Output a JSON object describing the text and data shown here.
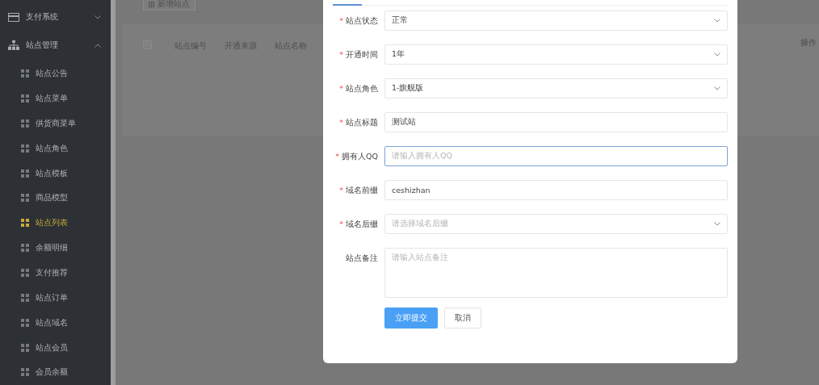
{
  "sidebar": {
    "groups": [
      {
        "label": "支付系统",
        "expanded": false
      },
      {
        "label": "站点管理",
        "expanded": true,
        "children": [
          {
            "label": "站点公告",
            "selected": false
          },
          {
            "label": "站点菜单",
            "selected": false
          },
          {
            "label": "供货商菜单",
            "selected": false
          },
          {
            "label": "站点角色",
            "selected": false
          },
          {
            "label": "站点模板",
            "selected": false
          },
          {
            "label": "商品模型",
            "selected": false
          },
          {
            "label": "站点列表",
            "selected": true
          },
          {
            "label": "余额明细",
            "selected": false
          },
          {
            "label": "支付推荐",
            "selected": false
          },
          {
            "label": "站点订单",
            "selected": false
          },
          {
            "label": "站点域名",
            "selected": false
          },
          {
            "label": "站点会员",
            "selected": false
          },
          {
            "label": "会员余额",
            "selected": false
          }
        ]
      }
    ]
  },
  "toolbar": {
    "add_button": "新增站点"
  },
  "table": {
    "select_all_checked": false,
    "columns": [
      "站点编号",
      "开通来源",
      "站点名称"
    ],
    "action_column": "操作"
  },
  "modal": {
    "fields": [
      {
        "label": "站点状态",
        "required_mark": "*",
        "kind": "select",
        "value": "正常"
      },
      {
        "label": "开通时间",
        "required_mark": "*",
        "kind": "select",
        "value": "1年"
      },
      {
        "label": "站点角色",
        "required_mark": "*",
        "kind": "select",
        "value": "1-旗舰版"
      },
      {
        "label": "站点标题",
        "required_mark": "*",
        "kind": "input",
        "value": "测试站"
      },
      {
        "label": "拥有人QQ",
        "required_mark": "*",
        "kind": "input",
        "placeholder": "请输入拥有人QQ",
        "focused": true
      },
      {
        "label": "域名前缀",
        "required_mark": "*",
        "kind": "input",
        "value": "ceshizhan"
      },
      {
        "label": "域名后缀",
        "required_mark": "*",
        "kind": "select",
        "placeholder": "请选择域名后缀"
      },
      {
        "label": "站点备注",
        "kind": "textarea",
        "placeholder": "请输入站点备注"
      }
    ],
    "buttons": [
      {
        "label": "立即提交",
        "kind": "primary"
      },
      {
        "label": "取消",
        "kind": "default"
      }
    ]
  }
}
